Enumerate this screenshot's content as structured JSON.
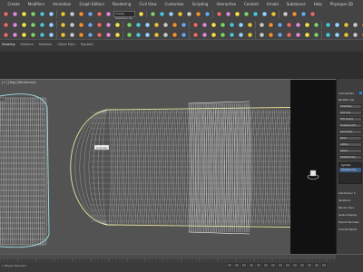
{
  "menu": [
    "Create",
    "Modifiers",
    "Animation",
    "Graph Editors",
    "Rendering",
    "Civil View",
    "Customize",
    "Scripting",
    "Interactive",
    "Content",
    "Arnold",
    "Substance",
    "Help",
    "Physique 3D"
  ],
  "toolbar1": {
    "selection_set_placeholder": "Create Selection Se",
    "icons": [
      "undo-icon",
      "redo-icon",
      "link-icon",
      "unlink-icon",
      "bind-icon",
      "select-icon",
      "select-by-name-icon",
      "rect-select-icon",
      "window-crossing-icon",
      "move-icon",
      "rotate-icon",
      "scale-icon",
      "ref-coord-icon",
      "pivot-icon",
      "select-manipulate-icon",
      "keyboard-shortcut-icon",
      "snap-icon",
      "angle-snap-icon",
      "percent-snap-icon",
      "spinner-snap-icon",
      "edit-named-sets-icon",
      "mirror-icon",
      "align-icon",
      "layer-icon",
      "ribbon-toggle-icon",
      "curve-editor-icon",
      "schematic-icon",
      "material-editor-icon",
      "render-setup-icon",
      "render-frame-icon",
      "render-icon"
    ]
  },
  "toolbar2": {
    "icons": [
      "teapot-icon",
      "sphere-icon",
      "box-icon",
      "cylinder-icon",
      "cone-icon",
      "torus-icon",
      "plane-icon",
      "light-icon",
      "camera-icon",
      "helper-icon",
      "spacewarp-icon",
      "system-icon",
      "modifier-icon",
      "bend-icon",
      "twist-icon",
      "taper-icon",
      "noise-icon",
      "shell-icon",
      "symmetry-icon",
      "turbosmooth-icon",
      "uvw-icon",
      "unwrap-icon",
      "skin-icon",
      "morpher-icon",
      "path-icon",
      "particle-icon",
      "cloth-icon",
      "hair-icon",
      "mass-fx-icon",
      "scene-explorer-icon",
      "layer-explorer-icon",
      "container-icon",
      "xref-icon",
      "grid-icon",
      "isolate-icon",
      "lock-icon",
      "render-region-icon",
      "viewport-icon",
      "safe-frame-icon",
      "arnold-icon",
      "material-icon",
      "bitmap-icon",
      "map-icon",
      "light-lister-icon",
      "exposure-icon",
      "render-icon",
      "env-icon"
    ]
  },
  "ribbon": {
    "tabs": [
      "Modeling",
      "Freeform",
      "Selection",
      "Object Paint",
      "Populate"
    ]
  },
  "viewport": {
    "label": "[+] [Top] [Wireframe]",
    "callout_label": "Cylinder"
  },
  "command_panel": {
    "object_name": "Cylinder001",
    "modifier_list": "Modifier List",
    "rows": [
      "UVW Map",
      "Edit Poly",
      "FFD 4x4x4",
      "Turbosmooth",
      "Symmetry",
      "Shell",
      "Lattice",
      "Select",
      "Editable Poly"
    ],
    "stack_items": [
      "Cylinder",
      "Editable Poly"
    ],
    "sections": [
      "Subdivision S",
      "Iterations",
      "Render Iters",
      "Isoline Display",
      "Explicit Normals",
      "Smooth Result"
    ],
    "swatch_color": "#2f7fd4"
  },
  "status": {
    "text": "1 Object Selected",
    "frame_label": "0 / 100"
  },
  "colors": {
    "wire_white": "#ffffff",
    "wire_selected": "#e8e69a",
    "wire_cyan": "#9fe0e6",
    "viewport_bg": "#535353"
  }
}
